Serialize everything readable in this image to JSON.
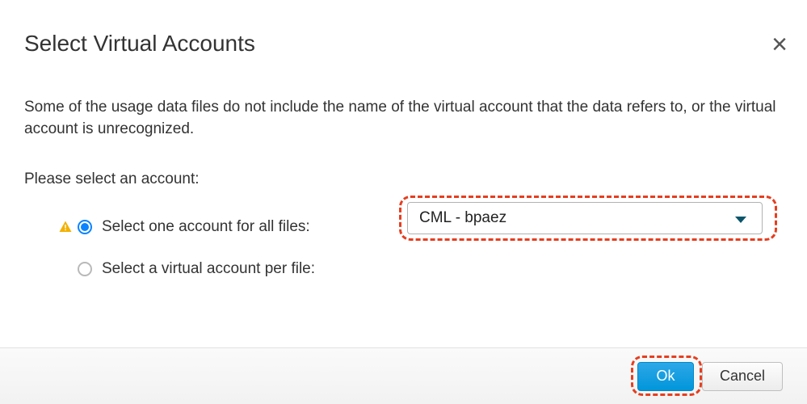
{
  "title": "Select Virtual Accounts",
  "description": "Some of the usage data files do not include the name of the virtual account that the data refers to, or the virtual account is unrecognized.",
  "prompt": "Please select an account:",
  "options": {
    "all": "Select one account for all files:",
    "perFile": "Select a virtual account per file:"
  },
  "dropdown": {
    "selected": "CML - bpaez"
  },
  "footer": {
    "ok": "Ok",
    "cancel": "Cancel"
  },
  "close": "×"
}
